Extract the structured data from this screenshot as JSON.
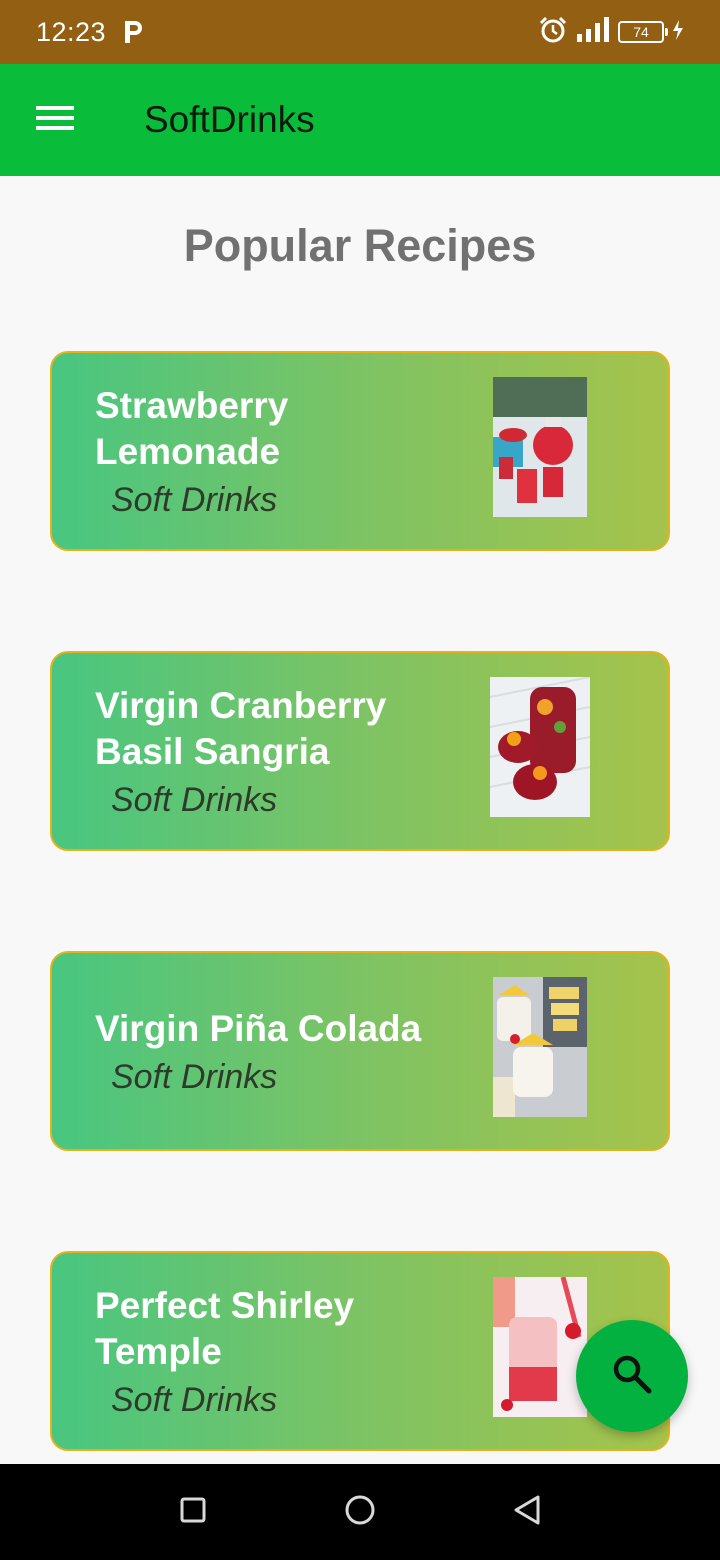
{
  "status": {
    "time": "12:23",
    "battery": "74"
  },
  "app_bar": {
    "title": "SoftDrinks",
    "menu_icon": "hamburger-menu-icon"
  },
  "heading": "Popular Recipes",
  "recipes": [
    {
      "title_line1": "Strawberry",
      "title_line2": "Lemonade",
      "category": "Soft Drinks"
    },
    {
      "title_line1": "Virgin Cranberry",
      "title_line2": "Basil Sangria",
      "category": "Soft Drinks"
    },
    {
      "title_line1": "Virgin Piña Colada",
      "title_line2": "",
      "category": "Soft Drinks"
    },
    {
      "title_line1": "Perfect Shirley",
      "title_line2": "Temple",
      "category": "Soft Drinks"
    }
  ],
  "fab": {
    "icon": "search-icon"
  },
  "colors": {
    "status_bar": "#935f12",
    "app_bar": "#09bd3b",
    "card_border": "#e6b21a",
    "fab": "#02b13f"
  }
}
